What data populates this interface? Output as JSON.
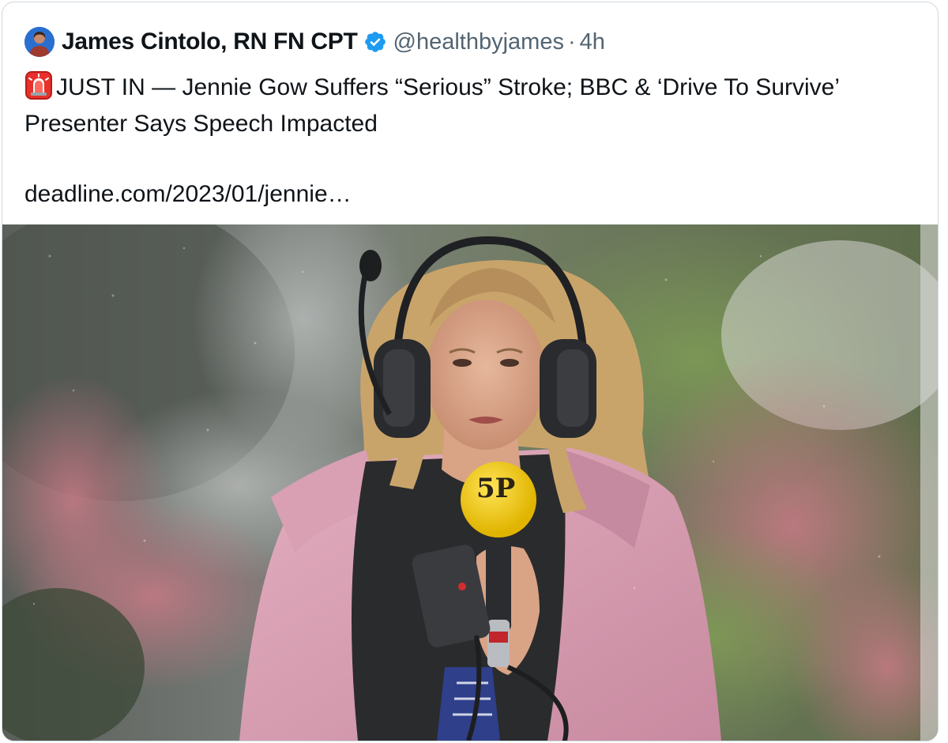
{
  "tweet": {
    "author": {
      "name": "James Cintolo, RN FN CPT",
      "handle": "@healthbyjames",
      "verified": true,
      "avatar_icon": "avatar-photo"
    },
    "separator": "·",
    "time": "4h",
    "text_icon": "rotating-light-icon",
    "text": "JUST IN — Jennie Gow Suffers “Serious” Stroke; BBC & ‘Drive To Survive’ Presenter Says Speech Impacted",
    "link": "deadline.com/2023/01/jennie…",
    "media": {
      "microphone_text": "5P"
    }
  },
  "colors": {
    "text_primary": "#0f1419",
    "text_secondary": "#536471",
    "verified_blue": "#1d9bf0",
    "border": "#cfd9de",
    "mic_yellow": "#f2cb1b",
    "jacket_pink": "#d9a0b4"
  }
}
